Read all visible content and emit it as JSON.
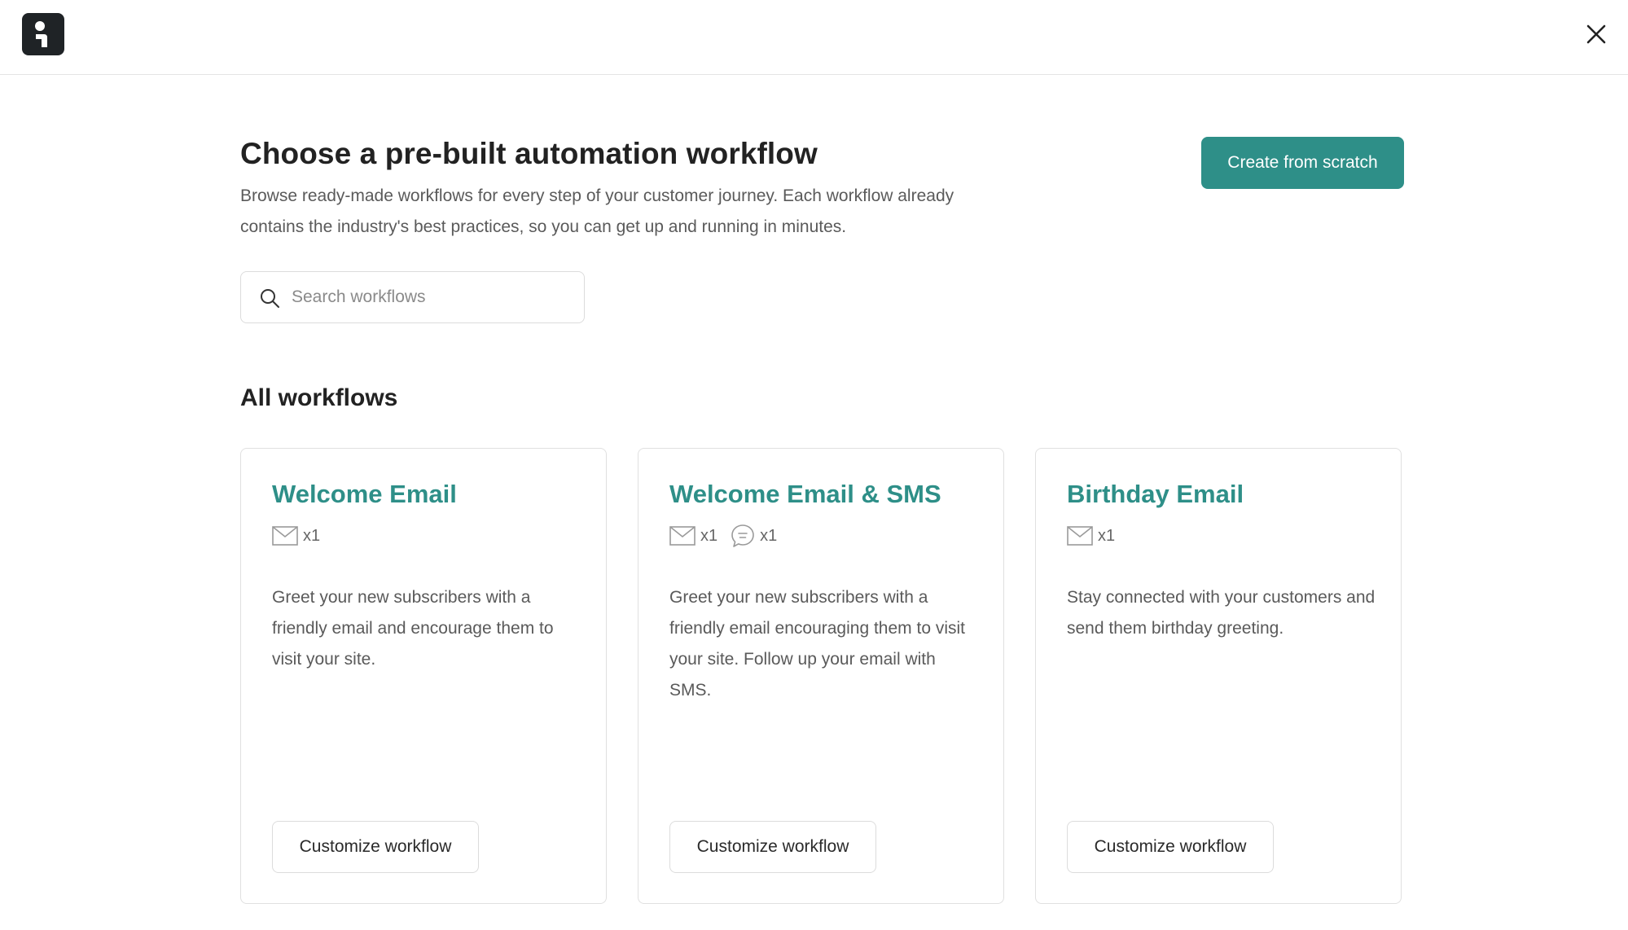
{
  "header": {
    "title": "Choose a pre-built automation workflow",
    "description": "Browse ready-made workflows for every step of your customer journey. Each workflow already contains the industry's best practices, so you can get up and running in minutes.",
    "create_button": "Create from scratch"
  },
  "search": {
    "placeholder": "Search workflows"
  },
  "section": {
    "title": "All workflows"
  },
  "cards": [
    {
      "title": "Welcome Email",
      "email_count": "x1",
      "description": "Greet your new subscribers with a friendly email and encourage them to visit your site.",
      "button": "Customize workflow"
    },
    {
      "title": "Welcome Email & SMS",
      "email_count": "x1",
      "sms_count": "x1",
      "description": "Greet your new subscribers with a friendly email encouraging them to visit your site. Follow up your email with SMS.",
      "button": "Customize workflow"
    },
    {
      "title": "Birthday Email",
      "email_count": "x1",
      "description": "Stay connected with your customers and send them birthday greeting.",
      "button": "Customize workflow"
    }
  ],
  "colors": {
    "accent": "#2e8f88",
    "logo_bg": "#1f2326"
  },
  "icons": {
    "logo": "brand-logo-icon",
    "close": "close-icon",
    "search": "search-icon",
    "email": "envelope-icon",
    "sms": "chat-bubble-icon"
  }
}
